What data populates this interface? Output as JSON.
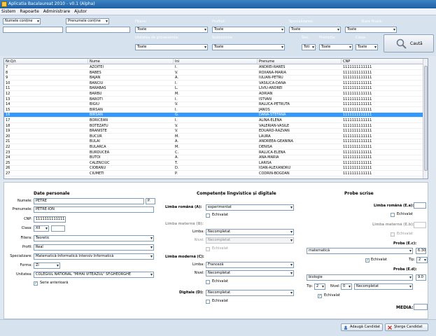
{
  "window": {
    "title": "Aplicatia Bacalaureat 2010 - v0.1 (Alpha)"
  },
  "menu": [
    "Sistem",
    "Rapoarte",
    "Administrare",
    "Ajutor"
  ],
  "filters": {
    "nume_cond": "Numele conține",
    "prenume_cond": "Prenumele conține",
    "filiera_label": "Filiera:",
    "filiera_value": "Toate",
    "profil_label": "Profilul:",
    "profil_value": "Toate",
    "spec_label": "Specializarea:",
    "spec_value": "Toate",
    "stare_label": "Stare finală:",
    "stare_value": "Toate",
    "unitate_label": "Unitatea de provenienta:",
    "unitate_value": "Toate",
    "subcomisie_label": "Subcomisie:",
    "subcomisie_value": "Toate",
    "sex_label": "Sex:",
    "sex_value": "Toti",
    "promotie_label": "Promoția:",
    "promotie_value": "Toate",
    "clasa_label": "Clasa:",
    "clasa_value": "Toate",
    "search_label": "Caută"
  },
  "grid": {
    "columns": [
      "Nr.Q/r.",
      "Nume",
      "Ini",
      "Prenume",
      "CNP"
    ],
    "rows": [
      [
        "7",
        "AZOITEI",
        "I.",
        "ANDREI-RARES",
        "1111111111111"
      ],
      [
        "8",
        "BABES",
        "V.",
        "ROXANA-MARIA",
        "1111111111111"
      ],
      [
        "9",
        "BĂJAN",
        "A.",
        "IULIAN-PETRU",
        "1111111111111"
      ],
      [
        "10",
        "BANCIU",
        "I.",
        "VASILICA-DANA",
        "1111111111111"
      ],
      [
        "11",
        "BARABAS",
        "L.",
        "LIVIU-ANDREI",
        "1111111111111"
      ],
      [
        "12",
        "BARBU",
        "M.",
        "ADRIAN",
        "1111111111111"
      ],
      [
        "13",
        "BAROTI",
        "I.",
        "ISTVAN",
        "1111111111111"
      ],
      [
        "14",
        "BÎGIU",
        "V.",
        "RALUCA-PETRUTA",
        "1111111111111"
      ],
      [
        "15",
        "BÎRSAN",
        "I.",
        "JÁNOS",
        "1111111111111"
      ],
      [
        "16",
        "BÎRSAN",
        "G.",
        "DANA-STEFANA",
        "1111111111111"
      ],
      [
        "17",
        "BORICEAN",
        "I.",
        "ALINA-ELENA",
        "1111111111111"
      ],
      [
        "18",
        "BOTEZATU",
        "V.",
        "VALERIAN-VASILE",
        "1111111111111"
      ],
      [
        "19",
        "BRANISTE",
        "V.",
        "EDUARD-RĂZVAN",
        "1111111111111"
      ],
      [
        "20",
        "BUCUR",
        "M.",
        "LAURA",
        "1111111111111"
      ],
      [
        "21",
        "BULAI",
        "A.",
        "ANDREEA-GEANINA",
        "1111111111111"
      ],
      [
        "22",
        "BULARCA",
        "M.",
        "DENISA",
        "1111111111111"
      ],
      [
        "23",
        "BURDUCEA",
        "C.",
        "RALUCA-ELENA",
        "1111111111111"
      ],
      [
        "24",
        "BUTOI",
        "A.",
        "ANA-MARIA",
        "1111111111111"
      ],
      [
        "25",
        "CALENCIUC",
        "T.",
        "LARISA",
        "1111111111111"
      ],
      [
        "26",
        "CIOBANU",
        "D.",
        "IOAN-ALEXANDRU",
        "1111111111111"
      ],
      [
        "27",
        "CIUMETI",
        "P.",
        "CODRIN-BOGDAN",
        "1111111111111"
      ]
    ],
    "selected_index": 9
  },
  "personal": {
    "title": "Date personale",
    "nume_label": "Numele:",
    "nume_value": "PETRE",
    "nume_init": "P.",
    "prenume_label": "Prenumele:",
    "prenume_value": "PETRE-ION",
    "cnp_label": "CNP:",
    "cnp_value": "1111111111111",
    "clasa_label": "Clasa:",
    "clasa_value": "XII",
    "filiera_label": "Filiera:",
    "filiera_value": "Teoretic",
    "profil_label": "Profil:",
    "profil_value": "Real",
    "spec_label": "Specializare:",
    "spec_value": "Matematică-Informatică Intensiv Informatică",
    "forma_label": "Forma:",
    "forma_value": "Zi",
    "unitatea_label": "Unitatea:",
    "unitatea_value": "COLEGIUL NATIONAL \"MIHAI VITEAZUL\" SF.GHEORGHE",
    "serie_label": "Serie anterioară"
  },
  "competente": {
    "title": "Competențe lingvistice și digitale",
    "romana_label": "Limba română (A):",
    "romana_value": "experimentat",
    "echivalat": "Echivalat",
    "materna_label": "Limba maternă (B):",
    "limba_label": "Limba:",
    "nivel_label": "Nivel:",
    "materna_limba_value": "Necompletat",
    "materna_nivel_value": "Necompletat",
    "moderna_label": "Limba modernă (C):",
    "moderna_limba_value": "Franceză",
    "moderna_nivel_value": "Necompletat",
    "digitale_label": "Digitale (D):",
    "digitale_value": "Necompletat"
  },
  "probe": {
    "title": "Probe scrise",
    "romana_label": "Limba română (E.a):",
    "materna_label": "Limba maternă (E.b):",
    "ec_label": "Proba (E.c):",
    "ec_value": "matematică",
    "ec_nota": "6.30",
    "ec_tip_label": "Tip:",
    "ec_tip_value": "2",
    "ed_label": "Proba (E.d):",
    "ed_value": "biologie",
    "ed_nota": "9.0",
    "tip_label": "Tip:",
    "tip_value": "2",
    "nivel_label": "Nivel:",
    "nivel_value": "0",
    "nivel_extra": "Necompletat",
    "echivalat": "Echivalat",
    "media_label": "MEDIA:"
  },
  "actions": {
    "add_label": "Adaugă Candidat",
    "delete_label": "Șterge Candidat"
  }
}
